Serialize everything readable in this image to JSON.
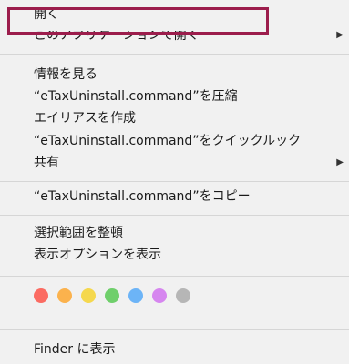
{
  "menu": {
    "open": "開く",
    "open_with": "このアプリケーションで開く",
    "get_info": "情報を見る",
    "compress": "“eTaxUninstall.command”を圧縮",
    "make_alias": "エイリアスを作成",
    "quick_look": "“eTaxUninstall.command”をクイックルック",
    "share": "共有",
    "copy": "“eTaxUninstall.command”をコピー",
    "clean_up_selection": "選択範囲を整頓",
    "show_view_options": "表示オプションを表示",
    "show_in_finder": "Finder に表示",
    "submenu_arrow": "▶"
  },
  "colors": {
    "highlight_border": "#9c1d4c",
    "tag_red": "#fb6b62",
    "tag_orange": "#fbb24d",
    "tag_yellow": "#f5d84e",
    "tag_green": "#6fcf6b",
    "tag_blue": "#6cb4f7",
    "tag_purple": "#d686ef",
    "tag_gray": "#b6b6b6"
  }
}
